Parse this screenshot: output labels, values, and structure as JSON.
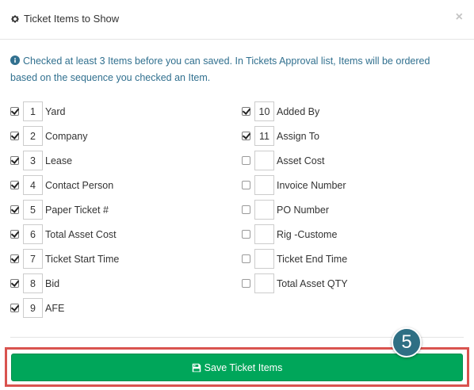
{
  "header": {
    "title": "Ticket Items to Show",
    "title_icon": "gear-icon",
    "close_label": "×"
  },
  "info": {
    "icon": "info-circle-icon",
    "text": "Checked at least 3 Items before you can saved. In Tickets Approval list, Items will be ordered based on the sequence you checked an Item."
  },
  "items_left": [
    {
      "checked": true,
      "seq": "1",
      "label": "Yard"
    },
    {
      "checked": true,
      "seq": "2",
      "label": "Company"
    },
    {
      "checked": true,
      "seq": "3",
      "label": "Lease"
    },
    {
      "checked": true,
      "seq": "4",
      "label": "Contact Person"
    },
    {
      "checked": true,
      "seq": "5",
      "label": "Paper Ticket #"
    },
    {
      "checked": true,
      "seq": "6",
      "label": "Total Asset Cost"
    },
    {
      "checked": true,
      "seq": "7",
      "label": "Ticket Start Time"
    },
    {
      "checked": true,
      "seq": "8",
      "label": "Bid"
    },
    {
      "checked": true,
      "seq": "9",
      "label": "AFE"
    }
  ],
  "items_right": [
    {
      "checked": true,
      "seq": "10",
      "label": "Added By"
    },
    {
      "checked": true,
      "seq": "11",
      "label": "Assign To"
    },
    {
      "checked": false,
      "seq": "",
      "label": "Asset Cost"
    },
    {
      "checked": false,
      "seq": "",
      "label": "Invoice Number"
    },
    {
      "checked": false,
      "seq": "",
      "label": "PO Number"
    },
    {
      "checked": false,
      "seq": "",
      "label": "Rig -Custome"
    },
    {
      "checked": false,
      "seq": "",
      "label": "Ticket End Time"
    },
    {
      "checked": false,
      "seq": "",
      "label": "Total Asset QTY"
    }
  ],
  "footer": {
    "save_label": "Save Ticket Items",
    "save_icon": "floppy-disk-icon"
  },
  "annotation": {
    "step_number": "5"
  },
  "colors": {
    "save_button": "#00a65a",
    "info_text": "#31708f",
    "highlight": "#d9534f",
    "step_badge": "#2e6f84"
  }
}
